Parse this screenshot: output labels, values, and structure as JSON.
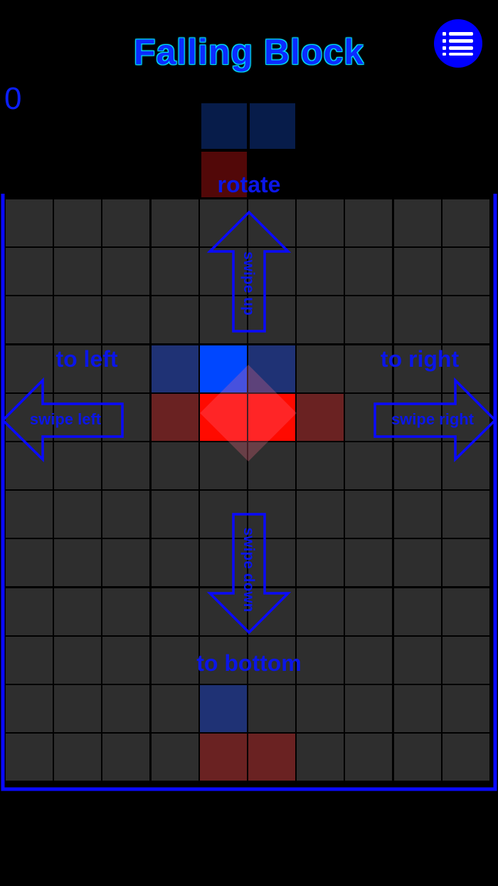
{
  "header": {
    "title": "Falling Block",
    "menu_icon": "list-menu-icon"
  },
  "score": {
    "value": "0"
  },
  "colors": {
    "background": "#000000",
    "cell_empty": "#2e2e2e",
    "grid_line": "#000000",
    "frame": "#0a0aff",
    "hint": "#0b16e8",
    "blue_block": "#0047ff",
    "red_block": "#ff0a00",
    "blue_ghost": "#1f3275",
    "red_ghost": "#6a2222",
    "next_blue": "#071c4a",
    "next_red": "#520808"
  },
  "board": {
    "columns": 10,
    "rows": 12
  },
  "next_piece": {
    "cells": [
      {
        "col": 0,
        "row": 0,
        "color": "next_blue"
      },
      {
        "col": 1,
        "row": 0,
        "color": "next_blue"
      },
      {
        "col": 0,
        "row": 1,
        "color": "next_red"
      }
    ]
  },
  "active_piece": {
    "cells": [
      {
        "col": 4,
        "row": 3,
        "color": "blue_block"
      },
      {
        "col": 4,
        "row": 4,
        "color": "red_block"
      },
      {
        "col": 5,
        "row": 4,
        "color": "red_block"
      }
    ],
    "ghost_cells": [
      {
        "col": 3,
        "row": 3,
        "color": "blue_ghost"
      },
      {
        "col": 5,
        "row": 3,
        "color": "blue_ghost"
      },
      {
        "col": 3,
        "row": 4,
        "color": "red_ghost"
      },
      {
        "col": 6,
        "row": 4,
        "color": "red_ghost"
      }
    ]
  },
  "landing_preview": {
    "cells": [
      {
        "col": 4,
        "row": 10,
        "color": "blue_ghost"
      },
      {
        "col": 4,
        "row": 11,
        "color": "red_ghost"
      },
      {
        "col": 5,
        "row": 11,
        "color": "red_ghost"
      }
    ]
  },
  "hints": {
    "rotate_label": "rotate",
    "swipe_up": "swipe up",
    "left_label": "to left",
    "swipe_left": "swipe left",
    "right_label": "to right",
    "swipe_right": "swipe right",
    "bottom_label": "to bottom",
    "swipe_down": "swipe down"
  }
}
